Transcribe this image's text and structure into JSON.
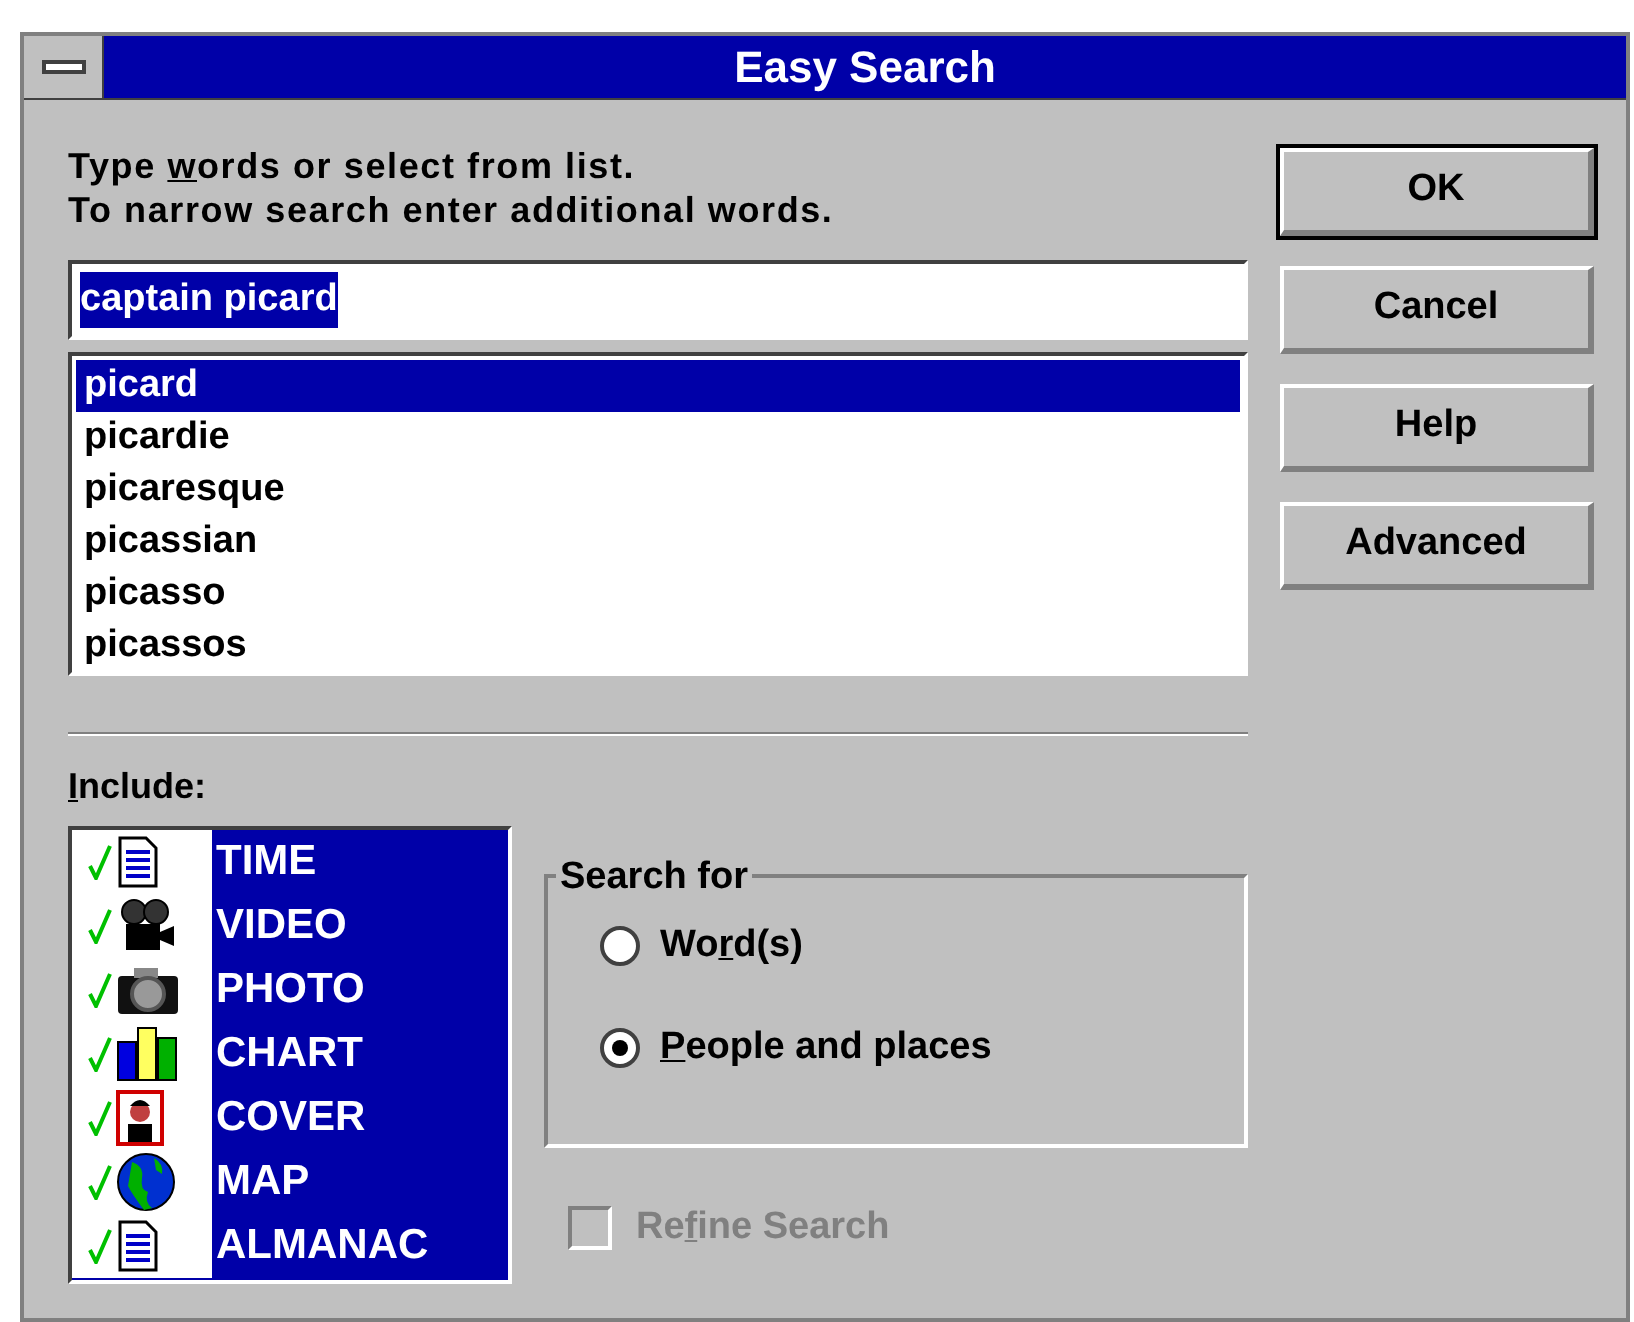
{
  "window": {
    "title": "Easy Search"
  },
  "instructions": [
    {
      "parts": [
        {
          "text": "Type ",
          "underline": false
        },
        {
          "text": "w",
          "underline": true
        },
        {
          "text": "ords or select from list.",
          "underline": false
        }
      ]
    },
    {
      "parts": [
        {
          "text": "To narrow search enter additional words.",
          "underline": false
        }
      ]
    }
  ],
  "search_field": {
    "value": "captain picard",
    "selected": true
  },
  "word_list": [
    {
      "label": "picard",
      "selected": true
    },
    {
      "label": "picardie",
      "selected": false
    },
    {
      "label": "picaresque",
      "selected": false
    },
    {
      "label": "picassian",
      "selected": false
    },
    {
      "label": "picasso",
      "selected": false
    },
    {
      "label": "picassos",
      "selected": false
    }
  ],
  "buttons": [
    {
      "label": "OK",
      "default": true
    },
    {
      "label": "Cancel",
      "default": false
    },
    {
      "label": "Help",
      "default": false
    },
    {
      "label": "Advanced",
      "default": false
    }
  ],
  "include": {
    "label_parts": [
      {
        "text": "I",
        "underline": true
      },
      {
        "text": "nclude:",
        "underline": false
      }
    ],
    "items": [
      {
        "label": "TIME",
        "kind": "document",
        "checked": true,
        "selected": true
      },
      {
        "label": "VIDEO",
        "kind": "camera",
        "checked": true,
        "selected": true
      },
      {
        "label": "PHOTO",
        "kind": "photo",
        "checked": true,
        "selected": true
      },
      {
        "label": "CHART",
        "kind": "chart",
        "checked": true,
        "selected": true
      },
      {
        "label": "COVER",
        "kind": "cover",
        "checked": true,
        "selected": true
      },
      {
        "label": "MAP",
        "kind": "globe",
        "checked": true,
        "selected": true
      },
      {
        "label": "ALMANAC",
        "kind": "document",
        "checked": true,
        "selected": true
      }
    ]
  },
  "search_for": {
    "title": "Search for",
    "options": [
      {
        "parts": [
          {
            "text": "Wo",
            "underline": false
          },
          {
            "text": "r",
            "underline": true
          },
          {
            "text": "d(s)",
            "underline": false
          }
        ],
        "selected": false
      },
      {
        "parts": [
          {
            "text": "P",
            "underline": true
          },
          {
            "text": "eople and places",
            "underline": false
          }
        ],
        "selected": true
      }
    ]
  },
  "refine": {
    "parts": [
      {
        "text": "Re",
        "underline": false
      },
      {
        "text": "f",
        "underline": true
      },
      {
        "text": "ine Search",
        "underline": false
      }
    ],
    "checked": false,
    "disabled": true
  }
}
